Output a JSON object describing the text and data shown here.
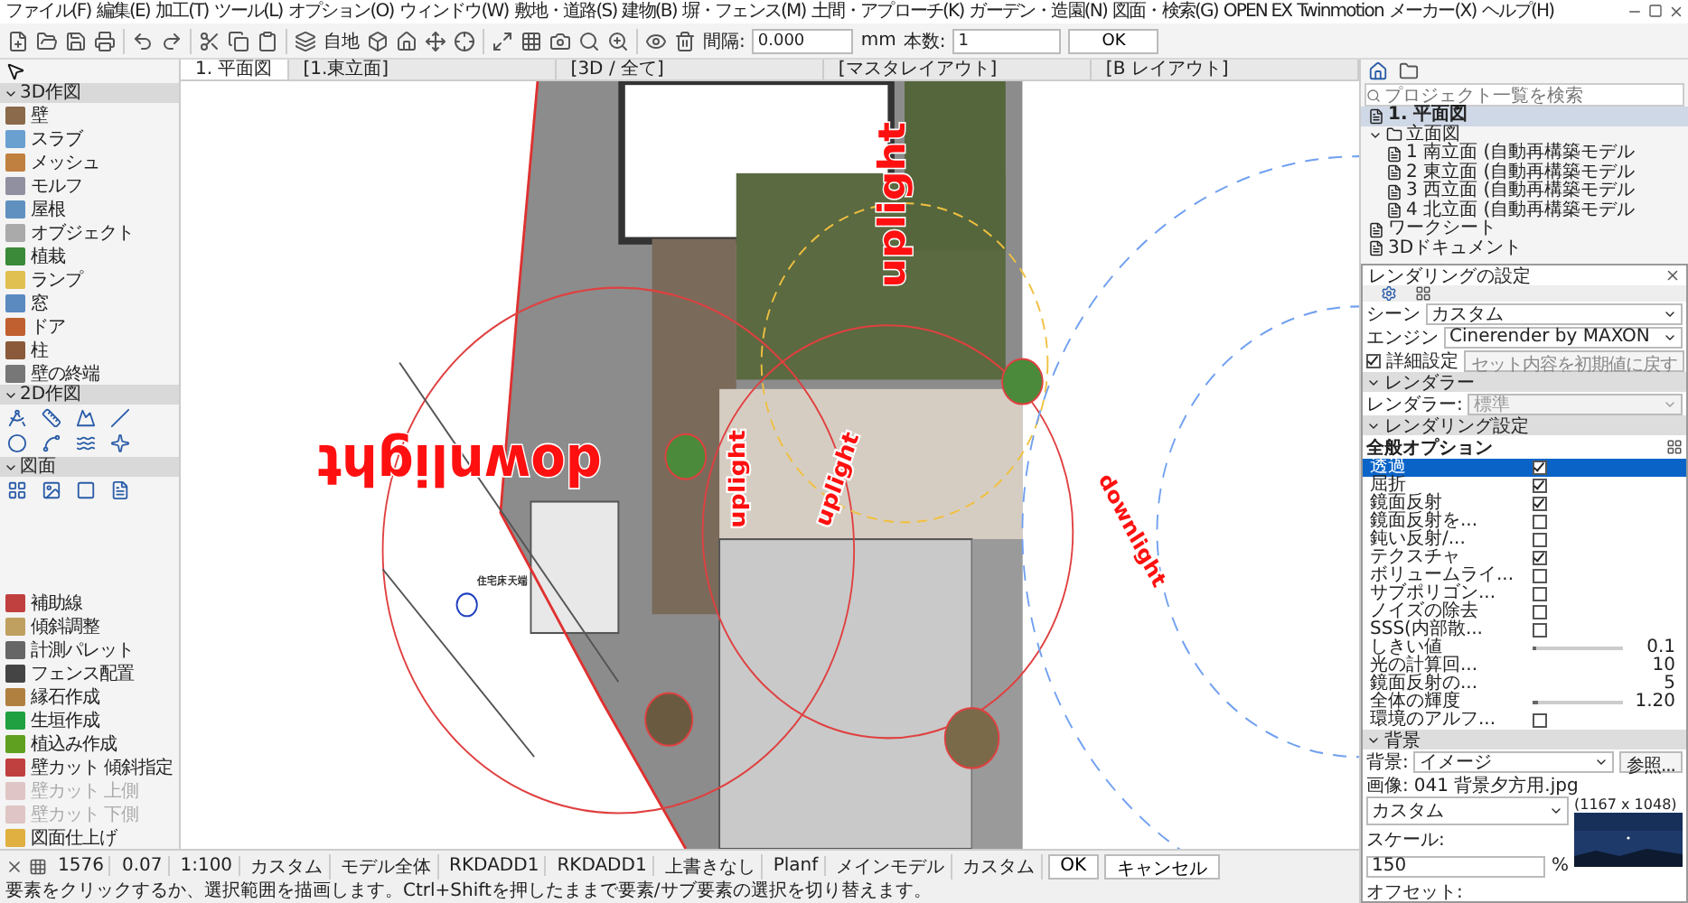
{
  "menu": [
    "ファイル(F)",
    "編集(E)",
    "加工(T)",
    "ツール(L)",
    "オプション(O)",
    "ウィンドウ(W)",
    "敷地・道路(S)",
    "建物(B)",
    "塀・フェンス(M)",
    "土間・アプローチ(K)",
    "ガーデン・造園(N)",
    "図面・検索(G)",
    "OPEN EX",
    "Twinmotion",
    "メーカー(X)",
    "ヘルプ(H)"
  ],
  "toolbar": {
    "story": "自地",
    "spacing_label": "間隔:",
    "spacing_value": "0.000",
    "unit": "mm",
    "count_label": "本数:",
    "count_value": "1",
    "ok": "OK"
  },
  "view_tabs": [
    {
      "label": "1. 平面図",
      "selected": true
    },
    {
      "label": "[1.東立面]",
      "selected": false
    },
    {
      "label": "[3D / 全て]",
      "selected": false
    },
    {
      "label": "[マスタレイアウト]",
      "selected": false
    },
    {
      "label": "[B レイアウト]",
      "selected": false
    }
  ],
  "toolbox": {
    "sections": [
      {
        "title": "3D作図",
        "expanded": true,
        "kind": "list",
        "items": [
          "壁",
          "スラブ",
          "メッシュ",
          "モルフ",
          "屋根",
          "オブジェクト",
          "植栽",
          "ランプ",
          "窓",
          "ドア",
          "柱",
          "壁の終端"
        ]
      },
      {
        "title": "2D作図",
        "expanded": true,
        "kind": "grid"
      },
      {
        "title": "図面",
        "expanded": true,
        "kind": "grid"
      }
    ],
    "extras": [
      {
        "label": "補助線",
        "disabled": false
      },
      {
        "label": "傾斜調整",
        "disabled": false
      },
      {
        "label": "計測パレット",
        "disabled": false
      },
      {
        "label": "フェンス配置",
        "disabled": false
      },
      {
        "label": "縁石作成",
        "disabled": false
      },
      {
        "label": "生垣作成",
        "disabled": false
      },
      {
        "label": "植込み作成",
        "disabled": false
      },
      {
        "label": "壁カット 傾斜指定",
        "disabled": false
      },
      {
        "label": "壁カット 上側",
        "disabled": true
      },
      {
        "label": "壁カット 下側",
        "disabled": true
      },
      {
        "label": "図面仕上げ",
        "disabled": false
      }
    ]
  },
  "plan_labels": [
    {
      "text": "downlight",
      "kind": "large"
    },
    {
      "text": "uplight",
      "kind": "medium"
    },
    {
      "text": "uplight",
      "kind": "small_a"
    },
    {
      "text": "uplight",
      "kind": "small_b"
    },
    {
      "text": "downlight",
      "kind": "small_c"
    },
    {
      "text": "住宅床天端",
      "kind": "note"
    }
  ],
  "navigator": {
    "search": {
      "placeholder": "プロジェクト一覧を検索"
    },
    "tree": [
      {
        "label": "1. 平面図",
        "selected": true
      },
      {
        "label": "立面図",
        "selected": false,
        "expanded": true,
        "children": [
          {
            "label": "1 南立面 (自動再構築モデル",
            "selected": false
          },
          {
            "label": "2 東立面 (自動再構築モデル",
            "selected": false
          },
          {
            "label": "3 西立面 (自動再構築モデル",
            "selected": false
          },
          {
            "label": "4 北立面 (自動再構築モデル",
            "selected": false
          }
        ]
      },
      {
        "label": "ワークシート",
        "selected": false
      },
      {
        "label": "3Dドキュメント",
        "selected": false
      }
    ]
  },
  "render_dialog": {
    "title": "レンダリングの設定",
    "scene_label": "シーン",
    "scene": "カスタム",
    "engine_label": "エンジン",
    "engine": "Cinerender by MAXON",
    "detail": {
      "label": "詳細設定",
      "checked": true
    },
    "reset_button": "セット内容を初期値に戻す",
    "renderer_section": {
      "title": "レンダラー",
      "expanded": true
    },
    "renderer_label": "レンダラー:",
    "renderer": "標準",
    "settings_section": {
      "title": "レンダリング設定",
      "expanded": true
    },
    "options_title": "全般オプション",
    "options": [
      {
        "kind": "check",
        "label": "透過",
        "checked": true,
        "selected": true
      },
      {
        "kind": "check",
        "label": "屈折",
        "checked": true,
        "selected": false
      },
      {
        "kind": "check",
        "label": "鏡面反射",
        "checked": true,
        "selected": false
      },
      {
        "kind": "check",
        "label": "鏡面反射を...",
        "checked": false,
        "selected": false
      },
      {
        "kind": "check",
        "label": "鈍い反射/...",
        "checked": false,
        "selected": false
      },
      {
        "kind": "check",
        "label": "テクスチャ",
        "checked": true,
        "selected": false
      },
      {
        "kind": "check",
        "label": "ボリュームライ...",
        "checked": false,
        "selected": false
      },
      {
        "kind": "check",
        "label": "サブポリゴン...",
        "checked": false,
        "selected": false
      },
      {
        "kind": "check",
        "label": "ノイズの除去",
        "checked": false,
        "selected": false
      },
      {
        "kind": "check",
        "label": "SSS(内部散...",
        "checked": false,
        "selected": false
      },
      {
        "kind": "slider",
        "label": "しきい値",
        "level": 0.02,
        "value": "0.1",
        "selected": false
      },
      {
        "kind": "number",
        "label": "光の計算回...",
        "value": "10",
        "selected": false
      },
      {
        "kind": "number",
        "label": "鏡面反射の...",
        "value": "5",
        "selected": false
      },
      {
        "kind": "slider",
        "label": "全体の輝度",
        "level": 0.05,
        "value": "1.20",
        "selected": false
      },
      {
        "kind": "check",
        "label": "環境のアルフ...",
        "checked": false,
        "selected": false
      }
    ],
    "background_section": {
      "title": "背景",
      "expanded": true
    },
    "background_label": "背景:",
    "background": "イメージ",
    "browse_button": "参照...",
    "image_label": "画像:",
    "image_file": "041 背景夕方用.jpg",
    "image_size": "(1167 x 1048)",
    "fit": "カスタム",
    "scale_label": "スケール:",
    "scale": "150",
    "scale_unit": "%",
    "offset_label": "オフセット:"
  },
  "bottom_bar": {
    "fields": [
      "1576",
      "0.07",
      "1:100",
      "カスタム",
      "モデル全体",
      "RKDADD1",
      "RKDADD1",
      "上書きなし",
      "Planf",
      "メインモデル",
      "カスタム"
    ],
    "ok": "OK",
    "cancel": "キャンセル"
  },
  "status_bar": "要素をクリックするか、選択範囲を描画します。Ctrl+Shiftを押したままで要素/サブ要素の選択を切り替えます。"
}
